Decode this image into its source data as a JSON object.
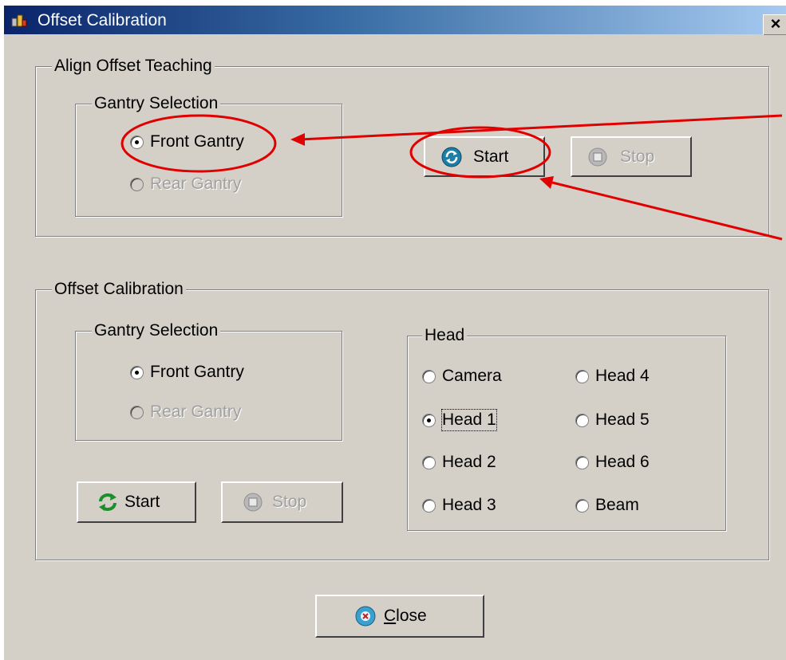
{
  "window": {
    "title": "Offset Calibration",
    "close_glyph": "×"
  },
  "align_group": {
    "legend": "Align Offset Teaching",
    "gantry": {
      "legend": "Gantry Selection",
      "front": {
        "label": "Front Gantry",
        "selected": true
      },
      "rear": {
        "label": "Rear Gantry",
        "enabled": false
      }
    },
    "start_label": "Start",
    "stop_label": "Stop"
  },
  "offset_group": {
    "legend": "Offset Calibration",
    "gantry": {
      "legend": "Gantry Selection",
      "front": {
        "label": "Front Gantry",
        "selected": true
      },
      "rear": {
        "label": "Rear Gantry",
        "enabled": false
      }
    },
    "start_label": "Start",
    "stop_label": "Stop",
    "head": {
      "legend": "Head",
      "options": [
        "Camera",
        "Head 1",
        "Head 2",
        "Head 3",
        "Head 4",
        "Head 5",
        "Head 6",
        "Beam"
      ],
      "selected": "Head 1"
    }
  },
  "close_button": {
    "label_mnemonic": "C",
    "label_rest": "lose"
  },
  "icons": {
    "app": "app-icon",
    "start_align": "refresh-icon",
    "start_offset": "sync-arrows-icon",
    "stop": "stop-icon",
    "close": "close-circle-icon"
  },
  "colors": {
    "annotation": "#e00000",
    "titlebar_start": "#0a246a",
    "titlebar_end": "#a6caf0",
    "face": "#d4d0c8"
  }
}
